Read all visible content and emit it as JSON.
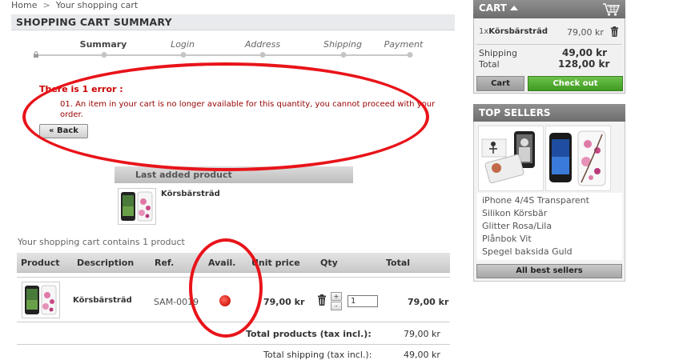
{
  "breadcrumb": {
    "home": "Home",
    "separator": ">",
    "current": "Your shopping cart"
  },
  "page_title": "SHOPPING CART SUMMARY",
  "steps": [
    "Summary",
    "Login",
    "Address",
    "Shipping",
    "Payment"
  ],
  "active_step": "Summary",
  "error": {
    "title": "There is 1 error :",
    "message": "01. An item in your cart is no longer available for this quantity, you cannot proceed with your order."
  },
  "back_button": "« Back",
  "last_added": {
    "header": "Last added product",
    "product_name": "Körsbärsträd"
  },
  "cart_contains": "Your shopping cart contains 1 product",
  "table": {
    "headers": [
      "Product",
      "Description",
      "Ref.",
      "Avail.",
      "Unit price",
      "Qty",
      "Total"
    ],
    "row": {
      "description": "Körsbärsträd",
      "ref": "SAM-0019",
      "unit_price": "79,00 kr",
      "qty": "1",
      "total": "79,00 kr",
      "avail_color": "#d8261b"
    },
    "qty_up": "+",
    "qty_down": "-",
    "total_products_label": "Total products (tax incl.):",
    "total_products_value": "79,00 kr",
    "total_shipping_label": "Total shipping (tax incl.):",
    "total_shipping_value": "49,00 kr"
  },
  "cart_block": {
    "title": "CART",
    "item_qty": "1x",
    "item_name": "Körsbärsträd",
    "item_price": "79,00 kr",
    "shipping_label": "Shipping",
    "shipping_value": "49,00 kr",
    "total_label": "Total",
    "total_value": "128,00 kr",
    "cart_button": "Cart",
    "checkout_button": "Check out"
  },
  "top_sellers": {
    "title": "TOP SELLERS",
    "items": [
      "iPhone 4/4S Transparent",
      "Silikon Körsbär",
      "Glitter Rosa/Lila",
      "Plånbok Vit",
      "Spegel baksida Guld"
    ],
    "all_button": "All best sellers"
  },
  "colors": {
    "annotation_red": "#e8141a",
    "checkout_green": "#4ea82c",
    "error_red": "#cc0000"
  }
}
